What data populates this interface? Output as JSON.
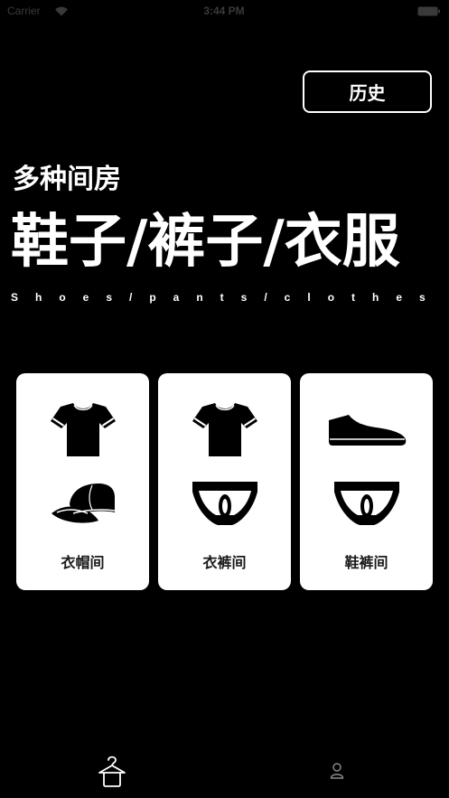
{
  "status_bar": {
    "carrier": "Carrier",
    "time": "3:44 PM",
    "icons": [
      "wifi-icon",
      "battery-icon"
    ]
  },
  "header": {
    "history_button_label": "历史"
  },
  "hero": {
    "subtitle": "多种间房",
    "title": "鞋子/裤子/衣服",
    "tagline": "Shoes/pants/clothes"
  },
  "cards": [
    {
      "label": "衣帽间",
      "icons": [
        "t-shirt-icon",
        "cap-icon"
      ]
    },
    {
      "label": "衣裤间",
      "icons": [
        "t-shirt-icon",
        "underpants-icon"
      ]
    },
    {
      "label": "鞋裤间",
      "icons": [
        "shoe-icon",
        "underpants-icon"
      ]
    }
  ],
  "tab_bar": {
    "items": [
      {
        "icon": "hanger-icon",
        "selected": true
      },
      {
        "icon": "person-icon",
        "selected": false
      }
    ]
  },
  "colors": {
    "background": "#000000",
    "text": "#ffffff",
    "card_background": "#ffffff",
    "card_label": "#1a1a1a",
    "status_bar_text": "#3a3a3a",
    "tab_selected": "#ffffff",
    "tab_unselected": "#8e8e8e"
  }
}
